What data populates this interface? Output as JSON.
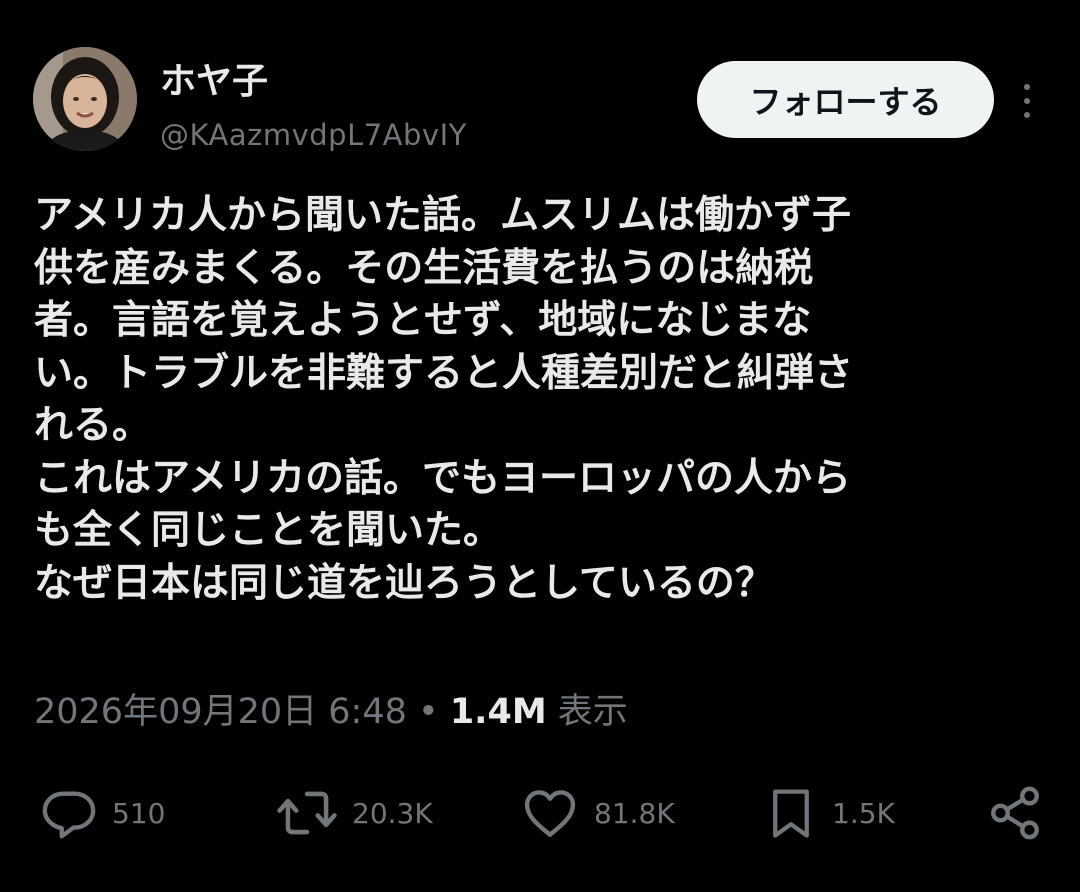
{
  "user": {
    "display_name": "ホヤ子",
    "handle": "@KAazmvdpL7AbvIY"
  },
  "follow_button_label": "フォローする",
  "tweet_lines": [
    "アメリカ人から聞いた話。ムスリムは働かず子",
    "供を産みまくる。その生活費を払うのは納税",
    "者。言語を覚えようとせず、地域になじまな",
    "い。トラブルを非難すると人種差別だと糾弾さ",
    "れる。",
    "これはアメリカの話。でもヨーロッパの人から",
    "も全く同じことを聞いた。",
    "なぜ日本は同じ道を辿ろうとしているの？"
  ],
  "meta": {
    "timestamp": "2026年09月20日 6:48",
    "separator": "•",
    "views_count": "1.4M",
    "views_label": "表示"
  },
  "actions": {
    "replies": "510",
    "reposts": "20.3K",
    "likes": "81.8K",
    "bookmarks": "1.5K"
  },
  "icons": {
    "reply": "reply-icon",
    "repost": "repost-icon",
    "like": "heart-icon",
    "bookmark": "bookmark-icon",
    "share": "share-icon",
    "more": "more-vertical-icon"
  },
  "colors": {
    "background": "#000000",
    "text_primary": "#e7e9ea",
    "text_secondary": "#71767b",
    "button_bg": "#eff3f4",
    "button_text": "#0f1419"
  }
}
